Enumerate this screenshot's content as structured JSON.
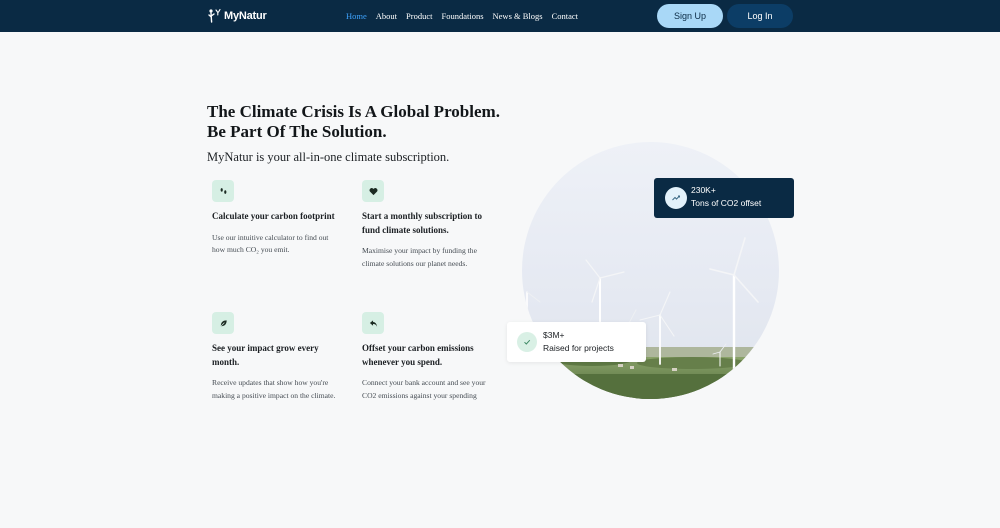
{
  "brand": {
    "name": "MyNatur"
  },
  "nav": {
    "items": [
      {
        "label": "Home",
        "active": true
      },
      {
        "label": "About",
        "active": false
      },
      {
        "label": "Product",
        "active": false
      },
      {
        "label": "Foundations",
        "active": false
      },
      {
        "label": "News & Blogs",
        "active": false
      },
      {
        "label": "Contact",
        "active": false
      }
    ],
    "signup_label": "Sign Up",
    "login_label": "Log In"
  },
  "hero": {
    "title": "The Climate Crisis Is A Global Problem. Be Part Of The Solution.",
    "subtitle": "MyNatur is your all-in-one climate subscription."
  },
  "features": [
    {
      "icon": "footprints-icon",
      "title": "Calculate your carbon footprint",
      "description": "Use our intuitive calculator to find out how much CO₂ you emit."
    },
    {
      "icon": "heart-icon",
      "title": "Start a monthly subscription to fund climate solutions.",
      "description": "Maximise your impact by funding the climate solutions our planet needs."
    },
    {
      "icon": "leaf-icon",
      "title": "See your impact grow every month.",
      "description": "Receive updates that show how you're making a positive impact on the climate."
    },
    {
      "icon": "return-arrow-icon",
      "title": "Offset your carbon emissions whenever you spend.",
      "description": "Connect your bank account and see your CO2 emissions against your spending"
    }
  ],
  "stats": {
    "co2": {
      "value": "230K+",
      "label": "Tons of CO2 offset",
      "icon": "trend-up-icon"
    },
    "raised": {
      "value": "$3M+",
      "label": "Raised for projects",
      "icon": "check-icon"
    }
  },
  "colors": {
    "nav_bg": "#0a2a44",
    "nav_active": "#3fa4ff",
    "signup_bg": "#a9d8f7",
    "login_bg": "#0c3d66",
    "icon_bg": "#d6efe4",
    "page_bg": "#f7f8f9"
  }
}
